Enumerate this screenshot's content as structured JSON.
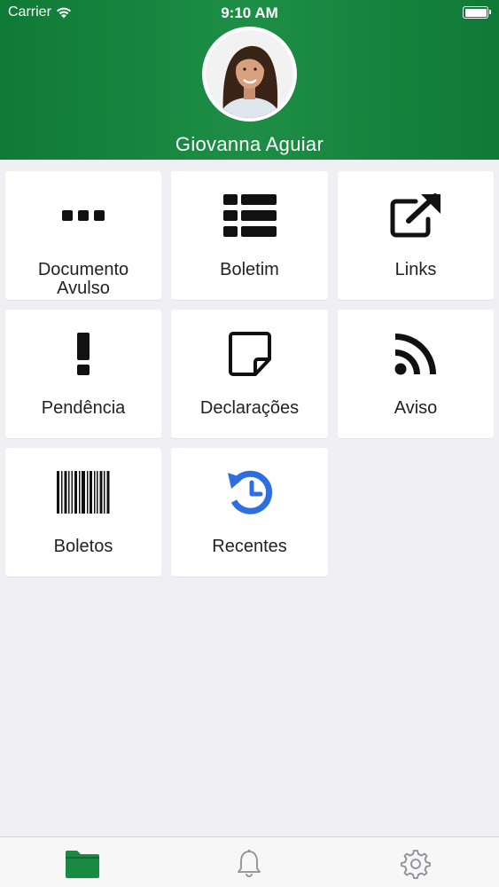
{
  "status_bar": {
    "carrier": "Carrier",
    "time": "9:10 AM",
    "wifi_icon": "wifi-icon",
    "battery_icon": "battery-icon"
  },
  "profile": {
    "name": "Giovanna Aguiar",
    "avatar_icon": "profile-photo"
  },
  "menu": [
    {
      "label": "Documento Avulso",
      "icon": "ellipsis-icon"
    },
    {
      "label": "Boletim",
      "icon": "list-icon"
    },
    {
      "label": "Links",
      "icon": "external-link-icon"
    },
    {
      "label": "Pendência",
      "icon": "exclamation-icon"
    },
    {
      "label": "Declarações",
      "icon": "sticky-note-icon"
    },
    {
      "label": "Aviso",
      "icon": "rss-icon"
    },
    {
      "label": "Boletos",
      "icon": "barcode-icon"
    },
    {
      "label": "Recentes",
      "icon": "history-icon"
    }
  ],
  "tab_bar": [
    {
      "icon": "folder-icon",
      "active": true
    },
    {
      "icon": "bell-icon",
      "active": false
    },
    {
      "icon": "gear-icon",
      "active": false
    }
  ],
  "colors": {
    "header_green": "#1a8a43",
    "active_tab": "#1a8a43",
    "recent_blue": "#2d6ee0",
    "background": "#efeff4"
  }
}
